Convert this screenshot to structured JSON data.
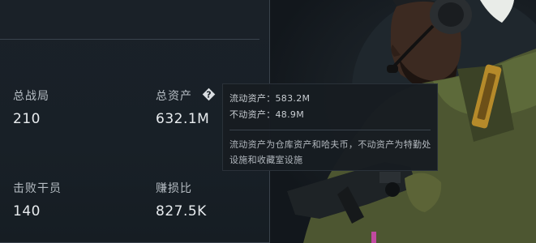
{
  "stats": {
    "total_matches": {
      "label": "总战局",
      "value": "210"
    },
    "total_assets": {
      "label": "总资产",
      "value": "632.1M"
    },
    "operators_defeated": {
      "label": "击败干员",
      "value": "140"
    },
    "profit_loss_ratio": {
      "label": "赚损比",
      "value": "827.5K"
    }
  },
  "tooltip": {
    "liquid_assets": "流动资产：583.2M",
    "fixed_assets": "不动资产：48.9M",
    "description": "流动资产为仓库资产和哈夫币，不动资产为特勤处设施和收藏室设施"
  },
  "icons": {
    "help": "question-mark-diamond-icon"
  }
}
